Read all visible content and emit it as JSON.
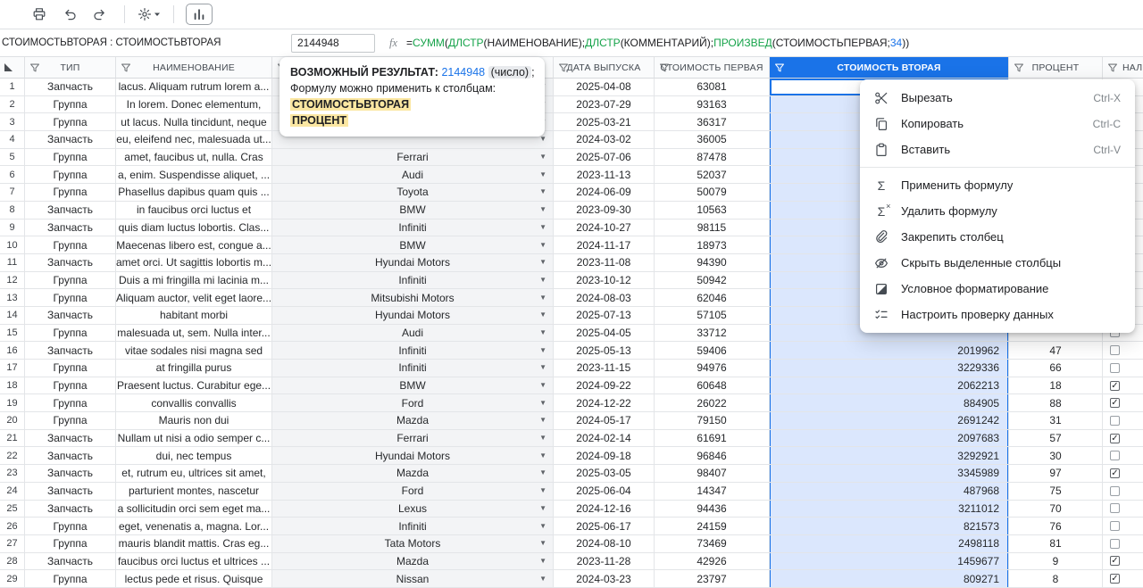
{
  "colors": {
    "accent_blue": "#1a73e8",
    "selected_column_bg": "#dbe7fd",
    "header_selected_bg": "#1a73e8",
    "highlight_yellow": "#fbe7a2",
    "formula_function_green": "#16a34a",
    "formula_number_blue": "#1a73e8",
    "dropdown_cell_bg": "#f3f4f6"
  },
  "toolbar": {
    "buttons": [
      {
        "icon": "print"
      },
      {
        "icon": "undo"
      },
      {
        "icon": "redo"
      },
      {
        "type": "separator"
      },
      {
        "icon": "gear",
        "caret": true
      },
      {
        "type": "separator"
      },
      {
        "icon": "bar-chart",
        "bordered": true
      }
    ]
  },
  "formula_bar": {
    "range_label": "СТОИМОСТЬВТОРАЯ : СТОИМОСТЬВТОРАЯ",
    "value": "2144948",
    "fx_label": "fx",
    "formula_segments": [
      {
        "text": "=",
        "color": "#202124"
      },
      {
        "text": "СУММ",
        "color": "#16a34a"
      },
      {
        "text": "(",
        "color": "#202124"
      },
      {
        "text": "ДЛСТР",
        "color": "#16a34a"
      },
      {
        "text": "(НАИМЕНОВАНИЕ);",
        "color": "#202124"
      },
      {
        "text": "ДЛСТР",
        "color": "#16a34a"
      },
      {
        "text": "(КОММЕНТАРИЙ);",
        "color": "#202124"
      },
      {
        "text": "ПРОИЗВЕД",
        "color": "#16a34a"
      },
      {
        "text": "(СТОИМОСТЬПЕРВАЯ;",
        "color": "#202124"
      },
      {
        "text": "34",
        "color": "#1a73e8"
      },
      {
        "text": "))",
        "color": "#202124"
      }
    ]
  },
  "tooltip": {
    "result_label": "ВОЗМОЖНЫЙ РЕЗУЛЬТАТ:",
    "result_value": "2144948",
    "result_type": "(число)",
    "result_suffix": ";",
    "apply_text": "Формулу можно применить к столбцам:",
    "columns": [
      "СТОИМОСТЬВТОРАЯ",
      "ПРОЦЕНТ"
    ]
  },
  "context_menu": {
    "items": [
      {
        "name": "cut",
        "icon": "scissors",
        "label": "Вырезать",
        "shortcut": "Ctrl-X"
      },
      {
        "name": "copy",
        "icon": "copy",
        "label": "Копировать",
        "shortcut": "Ctrl-C"
      },
      {
        "name": "paste",
        "icon": "paste",
        "label": "Вставить",
        "shortcut": "Ctrl-V"
      },
      {
        "type": "divider"
      },
      {
        "name": "apply-formula",
        "icon": "sigma",
        "label": "Применить формулу"
      },
      {
        "name": "delete-formula",
        "icon": "sigma-remove",
        "label": "Удалить формулу"
      },
      {
        "name": "pin-column",
        "icon": "paperclip",
        "label": "Закрепить столбец"
      },
      {
        "name": "hide-columns",
        "icon": "eye-off",
        "label": "Скрыть выделенные столбцы"
      },
      {
        "name": "conditional-formatting",
        "icon": "conditional-format",
        "label": "Условное форматирование"
      },
      {
        "name": "data-validation",
        "icon": "data-validation",
        "label": "Настроить проверку данных"
      }
    ]
  },
  "table": {
    "columns": [
      {
        "label": "",
        "key": "rownum"
      },
      {
        "label": "ТИП",
        "key": "type"
      },
      {
        "label": "НАИМЕНОВАНИЕ",
        "key": "name"
      },
      {
        "label": "",
        "key": "brand"
      },
      {
        "label": "ДАТА ВЫПУСКА",
        "key": "date"
      },
      {
        "label": "СТОИМОСТЬ ПЕРВАЯ",
        "key": "cost1"
      },
      {
        "label": "СТОИМОСТЬ ВТОРАЯ",
        "key": "cost2",
        "selected": true
      },
      {
        "label": "ПРОЦЕНТ",
        "key": "percent"
      },
      {
        "label": "НАЛ",
        "key": "checkbox"
      }
    ],
    "rows": [
      {
        "num": 1,
        "type": "Запчасть",
        "name": "lacus. Aliquam rutrum lorem a...",
        "brand": "",
        "date": "2025-04-08",
        "cost1": "63081",
        "cost2": "",
        "percent": "",
        "checked": null
      },
      {
        "num": 2,
        "type": "Группа",
        "name": "In lorem. Donec elementum,",
        "brand": "",
        "date": "2023-07-29",
        "cost1": "93163",
        "cost2": "",
        "percent": "",
        "checked": null
      },
      {
        "num": 3,
        "type": "Группа",
        "name": "ut lacus. Nulla tincidunt, neque",
        "brand": "",
        "date": "2025-03-21",
        "cost1": "36317",
        "cost2": "",
        "percent": "",
        "checked": null
      },
      {
        "num": 4,
        "type": "Запчасть",
        "name": "eu, eleifend nec, malesuada ut...",
        "brand": "",
        "date": "2024-03-02",
        "cost1": "36005",
        "cost2": "",
        "percent": "",
        "checked": null
      },
      {
        "num": 5,
        "type": "Группа",
        "name": "amet, faucibus ut, nulla. Cras",
        "brand": "Ferrari",
        "date": "2025-07-06",
        "cost1": "87478",
        "cost2": "",
        "percent": "",
        "checked": null
      },
      {
        "num": 6,
        "type": "Группа",
        "name": "a, enim. Suspendisse aliquet, ...",
        "brand": "Audi",
        "date": "2023-11-13",
        "cost1": "52037",
        "cost2": "",
        "percent": "",
        "checked": null
      },
      {
        "num": 7,
        "type": "Группа",
        "name": "Phasellus dapibus quam quis ...",
        "brand": "Toyota",
        "date": "2024-06-09",
        "cost1": "50079",
        "cost2": "",
        "percent": "",
        "checked": null
      },
      {
        "num": 8,
        "type": "Запчасть",
        "name": "in faucibus orci luctus et",
        "brand": "BMW",
        "date": "2023-09-30",
        "cost1": "10563",
        "cost2": "",
        "percent": "",
        "checked": null
      },
      {
        "num": 9,
        "type": "Запчасть",
        "name": "quis diam luctus lobortis. Clas...",
        "brand": "Infiniti",
        "date": "2024-10-27",
        "cost1": "98115",
        "cost2": "",
        "percent": "",
        "checked": null
      },
      {
        "num": 10,
        "type": "Группа",
        "name": "Maecenas libero est, congue a...",
        "brand": "BMW",
        "date": "2024-11-17",
        "cost1": "18973",
        "cost2": "",
        "percent": "",
        "checked": null
      },
      {
        "num": 11,
        "type": "Запчасть",
        "name": "amet orci. Ut sagittis lobortis m...",
        "brand": "Hyundai Motors",
        "date": "2023-11-08",
        "cost1": "94390",
        "cost2": "",
        "percent": "",
        "checked": null
      },
      {
        "num": 12,
        "type": "Группа",
        "name": "Duis a mi fringilla mi lacinia m...",
        "brand": "Infiniti",
        "date": "2023-10-12",
        "cost1": "50942",
        "cost2": "",
        "percent": "",
        "checked": null
      },
      {
        "num": 13,
        "type": "Группа",
        "name": "Aliquam auctor, velit eget laore...",
        "brand": "Mitsubishi Motors",
        "date": "2024-08-03",
        "cost1": "62046",
        "cost2": "",
        "percent": "",
        "checked": null
      },
      {
        "num": 14,
        "type": "Запчасть",
        "name": "habitant morbi",
        "brand": "Hyundai Motors",
        "date": "2025-07-13",
        "cost1": "57105",
        "cost2": "",
        "percent": "",
        "checked": null
      },
      {
        "num": 15,
        "type": "Группа",
        "name": "malesuada ut, sem. Nulla inter...",
        "brand": "Audi",
        "date": "2025-04-05",
        "cost1": "33712",
        "cost2": "",
        "percent": "",
        "checked": null
      },
      {
        "num": 16,
        "type": "Запчасть",
        "name": "vitae sodales nisi magna sed",
        "brand": "Infiniti",
        "date": "2025-05-13",
        "cost1": "59406",
        "cost2": "2019962",
        "percent": "47",
        "checked": false
      },
      {
        "num": 17,
        "type": "Группа",
        "name": "at fringilla purus",
        "brand": "Infiniti",
        "date": "2023-11-15",
        "cost1": "94976",
        "cost2": "3229336",
        "percent": "66",
        "checked": false
      },
      {
        "num": 18,
        "type": "Группа",
        "name": "Praesent luctus. Curabitur ege...",
        "brand": "BMW",
        "date": "2024-09-22",
        "cost1": "60648",
        "cost2": "2062213",
        "percent": "18",
        "checked": true
      },
      {
        "num": 19,
        "type": "Группа",
        "name": "convallis convallis",
        "brand": "Ford",
        "date": "2024-12-22",
        "cost1": "26022",
        "cost2": "884905",
        "percent": "88",
        "checked": true
      },
      {
        "num": 20,
        "type": "Группа",
        "name": "Mauris non dui",
        "brand": "Mazda",
        "date": "2024-05-17",
        "cost1": "79150",
        "cost2": "2691242",
        "percent": "31",
        "checked": false
      },
      {
        "num": 21,
        "type": "Запчасть",
        "name": "Nullam ut nisi a odio semper c...",
        "brand": "Ferrari",
        "date": "2024-02-14",
        "cost1": "61691",
        "cost2": "2097683",
        "percent": "57",
        "checked": true
      },
      {
        "num": 22,
        "type": "Запчасть",
        "name": "dui, nec tempus",
        "brand": "Hyundai Motors",
        "date": "2024-09-18",
        "cost1": "96846",
        "cost2": "3292921",
        "percent": "30",
        "checked": false
      },
      {
        "num": 23,
        "type": "Запчасть",
        "name": "et, rutrum eu, ultrices sit amet,",
        "brand": "Mazda",
        "date": "2025-03-05",
        "cost1": "98407",
        "cost2": "3345989",
        "percent": "97",
        "checked": true
      },
      {
        "num": 24,
        "type": "Запчасть",
        "name": "parturient montes, nascetur",
        "brand": "Ford",
        "date": "2025-06-04",
        "cost1": "14347",
        "cost2": "487968",
        "percent": "75",
        "checked": false
      },
      {
        "num": 25,
        "type": "Запчасть",
        "name": "a sollicitudin orci sem eget ma...",
        "brand": "Lexus",
        "date": "2024-12-16",
        "cost1": "94436",
        "cost2": "3211012",
        "percent": "70",
        "checked": false
      },
      {
        "num": 26,
        "type": "Группа",
        "name": "eget, venenatis a, magna. Lor...",
        "brand": "Infiniti",
        "date": "2025-06-17",
        "cost1": "24159",
        "cost2": "821573",
        "percent": "76",
        "checked": false
      },
      {
        "num": 27,
        "type": "Группа",
        "name": "mauris blandit mattis. Cras eg...",
        "brand": "Tata Motors",
        "date": "2024-08-10",
        "cost1": "73469",
        "cost2": "2498118",
        "percent": "81",
        "checked": false
      },
      {
        "num": 28,
        "type": "Запчасть",
        "name": "faucibus orci luctus et ultrices ...",
        "brand": "Mazda",
        "date": "2023-11-28",
        "cost1": "42926",
        "cost2": "1459677",
        "percent": "9",
        "checked": true
      },
      {
        "num": 29,
        "type": "Группа",
        "name": "lectus pede et risus. Quisque",
        "brand": "Nissan",
        "date": "2024-03-23",
        "cost1": "23797",
        "cost2": "809271",
        "percent": "8",
        "checked": true
      }
    ]
  }
}
